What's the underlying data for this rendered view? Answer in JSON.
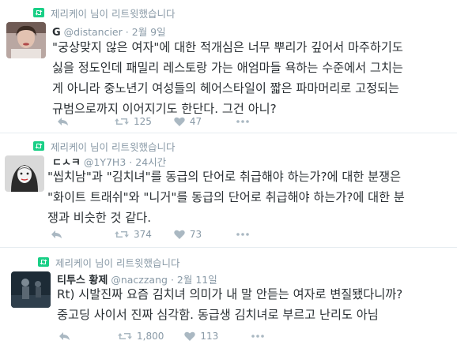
{
  "tweets": [
    {
      "retweet_label": "제리케이 님이 리트윗했습니다",
      "name": "G",
      "handle": "@distancier",
      "time": "2월 9일",
      "text": "\"궁상맞지 않은 여자\"에 대한 적개심은 너무 뿌리가 깊어서 마주하기도\n싫을 정도인데 패밀리 레스토랑 가는 애엄마들 욕하는 수준에서 그치는\n게 아니라 중노년기 여성들의 헤어스타일이 짧은 파마머리로 고정되는\n규범으로까지 이어지기도 한단다. 그건 아니?",
      "retweets": "125",
      "likes": "47"
    },
    {
      "retweet_label": "제리케이 님이 리트윗했습니다",
      "name": "ㄷㅅㅋ",
      "handle": "@1Y7H3",
      "time": "24시간",
      "text": "\"씹치남\"과 \"김치녀\"를 동급의 단어로 취급해야 하는가?에 대한 분쟁은\n\"화이트 트래쉬\"와 \"니거\"를 동급의 단어로 취급해야 하는가?에 대한 분\n쟁과 비슷한 것 같다.",
      "retweets": "374",
      "likes": "73"
    },
    {
      "retweet_label": "제리케이 님이 리트윗했습니다",
      "name": "티투스 황제",
      "handle": "@naczzang",
      "time": "2월 11일",
      "text": "Rt) 시발진짜 요즘 김치녀 의미가 내 말 안듣는 여자로 변질됐다니까?\n중고딩 사이서 진짜 심각함. 동급생 김치녀로 부르고 난리도 아님",
      "retweets": "1,800",
      "likes": "113"
    }
  ],
  "colors": {
    "retweet_green": "#19cf86",
    "muted": "#8899a6",
    "text": "#292f33",
    "separator": "#e6ecf0"
  }
}
